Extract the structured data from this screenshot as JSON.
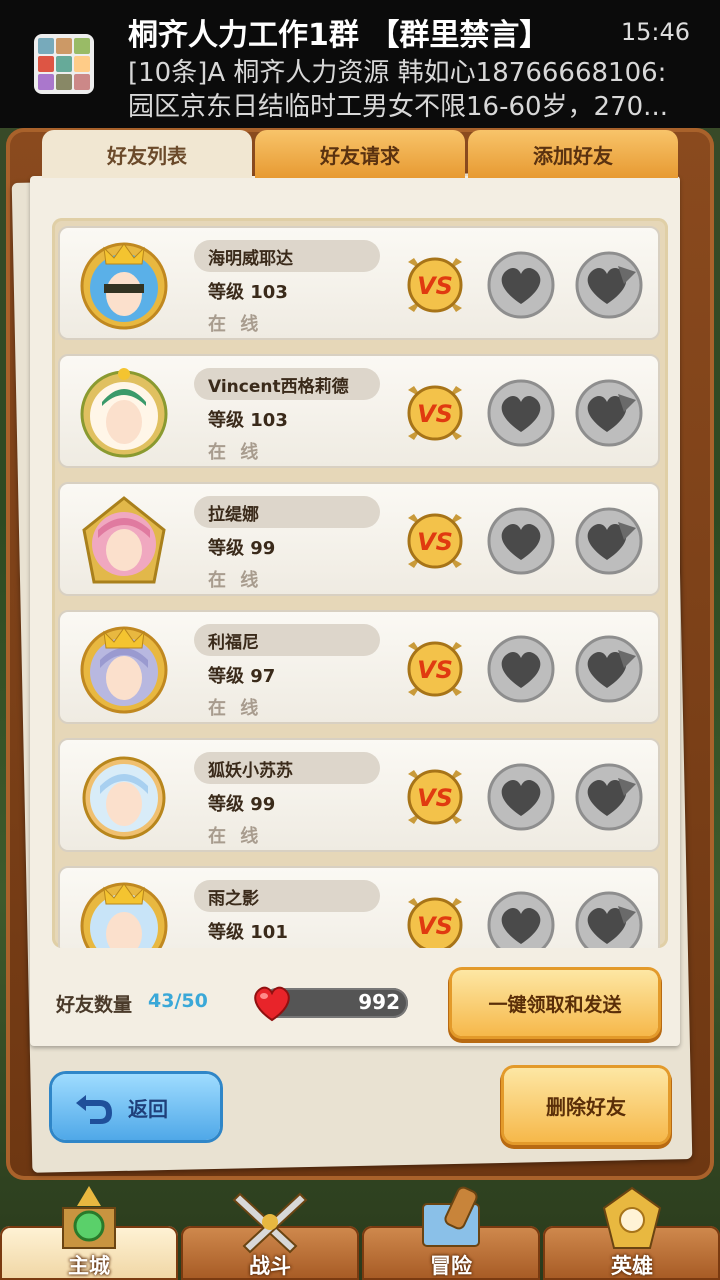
{
  "notification": {
    "title": "桐齐人力工作1群 【群里禁言】",
    "time": "15:46",
    "line1": "[10条]A 桐齐人力资源 韩如心18766668106:",
    "line2": "园区京东日结临时工男女不限16-60岁，270..."
  },
  "tabs": [
    {
      "label": "好友列表"
    },
    {
      "label": "好友请求"
    },
    {
      "label": "添加好友"
    }
  ],
  "friends": [
    {
      "name": "海明威耶达",
      "level": "等级 103",
      "status": "在 线"
    },
    {
      "name": "Vincent西格莉德",
      "level": "等级 103",
      "status": "在 线"
    },
    {
      "name": "拉缇娜",
      "level": "等级 99",
      "status": "在 线"
    },
    {
      "name": "利福尼",
      "level": "等级 97",
      "status": "在 线"
    },
    {
      "name": "狐妖小苏苏",
      "level": "等级 99",
      "status": "在 线"
    },
    {
      "name": "雨之影",
      "level": "等级 101",
      "status": ""
    }
  ],
  "footer": {
    "friend_count_label": "好友数量",
    "friend_count_value": "43/50",
    "stamina_value": "992",
    "collect_send_label": "一键领取和发送",
    "delete_label": "删除好友",
    "back_label": "返回"
  },
  "nav": [
    {
      "label": "主城"
    },
    {
      "label": "战斗"
    },
    {
      "label": "冒险"
    },
    {
      "label": "英雄"
    }
  ],
  "colors": {
    "accent_blue": "#3aa8d8",
    "gold": "#f6b84a",
    "wood": "#8a4a1e"
  }
}
